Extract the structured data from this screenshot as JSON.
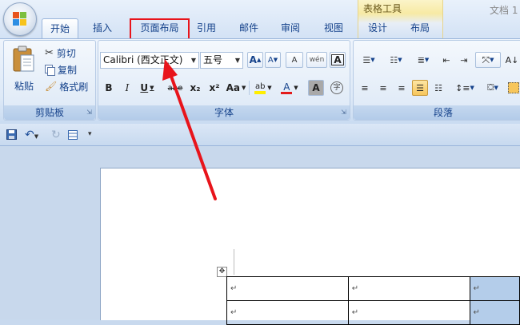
{
  "window": {
    "doc_title": "文档 1"
  },
  "tabs": [
    {
      "label": "开始",
      "active": true
    },
    {
      "label": "插入"
    },
    {
      "label": "页面布局",
      "highlighted": true
    },
    {
      "label": "引用"
    },
    {
      "label": "邮件"
    },
    {
      "label": "审阅"
    },
    {
      "label": "视图"
    },
    {
      "label": "设计"
    },
    {
      "label": "布局"
    }
  ],
  "contextual_group": {
    "label": "表格工具"
  },
  "clipboard": {
    "paste_label": "粘贴",
    "cut_label": "剪切",
    "copy_label": "复制",
    "format_painter_label": "格式刷",
    "group_label": "剪贴板"
  },
  "font": {
    "font_name": "Calibri (西文正文)",
    "font_size": "五号",
    "bold": "B",
    "italic": "I",
    "underline": "U",
    "strike": "abe",
    "subscript": "x₂",
    "superscript": "x²",
    "change_case": "Aa",
    "grow": "A",
    "shrink": "A",
    "clear": "A",
    "phonetic": "wén",
    "char_border": "A",
    "highlight": "ab",
    "font_color": "A",
    "char_shade": "A",
    "enclose": "字",
    "group_label": "字体"
  },
  "paragraph": {
    "group_label": "段落"
  },
  "table": {
    "rows": [
      [
        "↵",
        "↵",
        "↵"
      ],
      [
        "↵",
        "↵",
        "↵"
      ]
    ]
  },
  "colors": {
    "callout": "#e8141b",
    "selected_cell": "#b4cdea",
    "highlight_yellow": "#ffee00",
    "font_red": "#e31b1b"
  }
}
